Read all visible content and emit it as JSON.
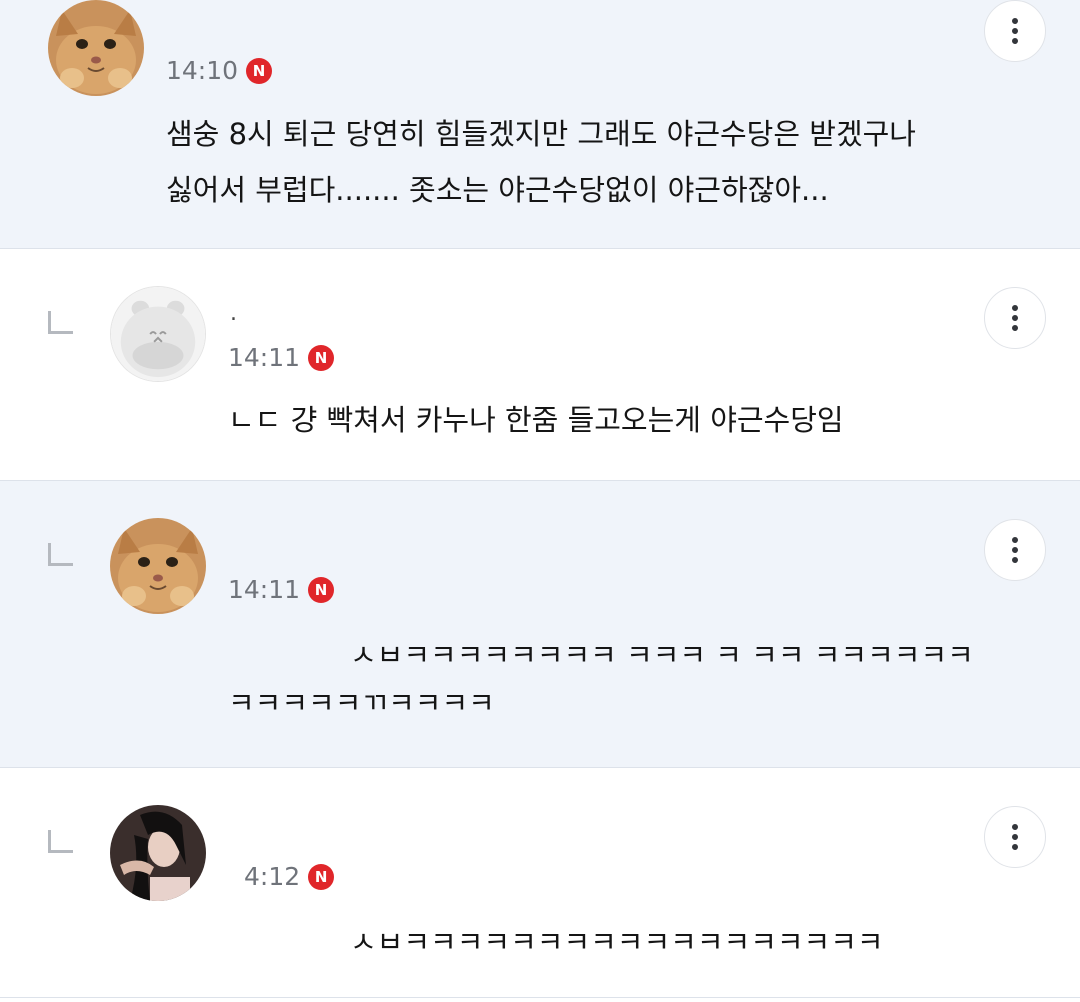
{
  "comments": [
    {
      "time": "14:10",
      "badge": "N",
      "lines": [
        "샘숭 8시 퇴근 당연히 힘들겠지만 그래도 야근수당은 받겠구나",
        "싫어서 부럽다....... 좃소는 야근수당없이 야근하잖아..."
      ],
      "avatar_icon": "cat-avatar-icon"
    },
    {
      "nickname": ".",
      "time": "14:11",
      "badge": "N",
      "lines": [
        "ㄴㄷ 걍 빡쳐서 카누나 한줌 들고오는게 야근수당임"
      ],
      "avatar_icon": "default-hamster-avatar-icon"
    },
    {
      "time": "14:11",
      "badge": "N",
      "lines": [
        "ㅅㅂㅋㅋㅋㅋㅋㅋㅋㅋ ㅋㅋㅋ ㅋ ㅋㅋ ㅋㅋㅋㅋㅋㅋ",
        "ㅋㅋㅋㅋㅋㄲㅋㅋㅋㅋ"
      ],
      "avatar_icon": "cat-avatar-icon"
    },
    {
      "time": "4:12",
      "badge": "N",
      "lines": [
        "ㅅㅂㅋㅋㅋㅋㅋㅋㅋㅋㅋㅋㅋㅋㅋㅋㅋㅋㅋㅋ"
      ],
      "avatar_icon": "person-avatar-icon"
    }
  ],
  "colors": {
    "highlight_bg": "#f0f4fa",
    "badge_red": "#e0262a",
    "time_gray": "#6f737a",
    "divider": "#dde2ea"
  }
}
